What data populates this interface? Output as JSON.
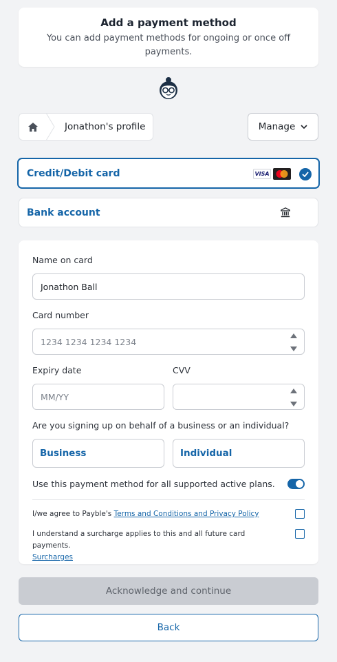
{
  "header": {
    "title": "Add a payment method",
    "subtitle": "You can add payment methods for ongoing or once off payments."
  },
  "breadcrumb": {
    "home_icon": "home-icon",
    "profile_label": "Jonathon's profile"
  },
  "manage_button": {
    "label": "Manage",
    "icon": "chevron-down-icon"
  },
  "payment_methods": {
    "credit_card": {
      "label": "Credit/Debit card",
      "selected": true,
      "visa_label": "VISA"
    },
    "bank_account": {
      "label": "Bank account",
      "selected": false,
      "icon": "bank-icon"
    }
  },
  "form": {
    "name_label": "Name on card",
    "name_value": "Jonathon Ball",
    "card_number_label": "Card number",
    "card_number_placeholder": "1234 1234 1234 1234",
    "expiry_label": "Expiry date",
    "expiry_placeholder": "MM/YY",
    "cvv_label": "CVV",
    "cvv_value": "",
    "entity_question": "Are you signing up on behalf of a business or an individual?",
    "business_label": "Business",
    "individual_label": "Individual",
    "all_plans_label": "Use this payment method for all supported active plans.",
    "all_plans_enabled": true,
    "terms_prefix": "I/we agree to Payble's",
    "terms_link": "Terms and Conditions and Privacy Policy",
    "terms_checked": false,
    "surcharge_text": "I understand a surcharge applies to this and all future card payments.",
    "surcharge_link": "Surcharges",
    "surcharge_checked": false
  },
  "actions": {
    "continue_label": "Acknowledge and continue",
    "back_label": "Back"
  },
  "colors": {
    "accent": "#1565a8",
    "background": "#f2f3f5",
    "disabled_button": "#c9ccd2"
  }
}
